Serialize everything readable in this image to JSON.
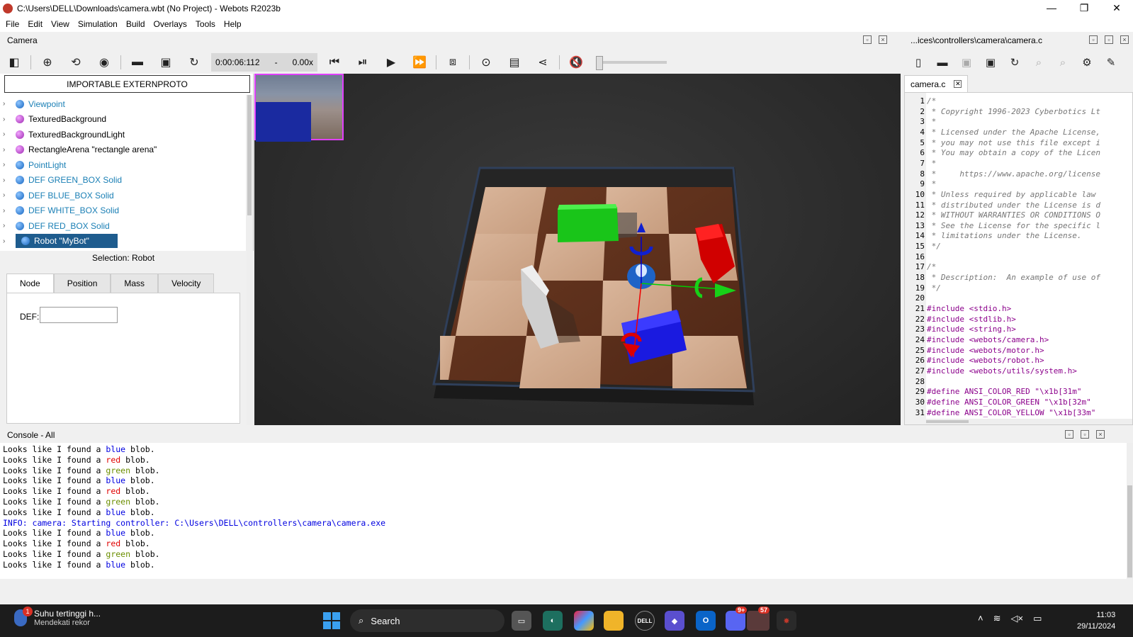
{
  "window": {
    "title": "C:\\Users\\DELL\\Downloads\\camera.wbt (No Project) - Webots R2023b",
    "minimize": "—",
    "maximize": "❐",
    "close": "✕"
  },
  "menu": [
    "File",
    "Edit",
    "View",
    "Simulation",
    "Build",
    "Overlays",
    "Tools",
    "Help"
  ],
  "camera_panel": {
    "title": "Camera"
  },
  "toolbar": {
    "time": "0:00:06:112",
    "separator": "-",
    "speed": "0.00x"
  },
  "scene_tree": {
    "extern_button": "IMPORTABLE EXTERNPROTO",
    "items": [
      {
        "label": "Viewpoint",
        "color": "blue",
        "text_color": "#1a7fb5"
      },
      {
        "label": "TexturedBackground",
        "color": "purple",
        "text_color": "#000000"
      },
      {
        "label": "TexturedBackgroundLight",
        "color": "purple",
        "text_color": "#000000"
      },
      {
        "label": "RectangleArena \"rectangle arena\"",
        "color": "purple",
        "text_color": "#000000"
      },
      {
        "label": "PointLight",
        "color": "blue",
        "text_color": "#1a7fb5"
      },
      {
        "label": "DEF GREEN_BOX Solid",
        "color": "blue",
        "text_color": "#1a7fb5"
      },
      {
        "label": "DEF BLUE_BOX Solid",
        "color": "blue",
        "text_color": "#1a7fb5"
      },
      {
        "label": "DEF WHITE_BOX Solid",
        "color": "blue",
        "text_color": "#1a7fb5"
      },
      {
        "label": "DEF RED_BOX Solid",
        "color": "blue",
        "text_color": "#1a7fb5"
      },
      {
        "label": "Robot \"MyBot\"",
        "color": "blue",
        "text_color": "#ffffff",
        "selected": true
      }
    ]
  },
  "selection": {
    "title": "Selection: Robot",
    "tabs": [
      "Node",
      "Position",
      "Mass",
      "Velocity"
    ],
    "active_tab": "Node",
    "def_label": "DEF:",
    "def_value": ""
  },
  "editor": {
    "title": "...ices\\controllers\\camera\\camera.c",
    "tab_label": "camera.c",
    "tab_close": "✕",
    "lines": [
      {
        "n": "1",
        "t": "/*",
        "k": "cmt"
      },
      {
        "n": "2",
        "t": " * Copyright 1996-2023 Cyberbotics Lt",
        "k": "cmt"
      },
      {
        "n": "3",
        "t": " *",
        "k": "cmt"
      },
      {
        "n": "4",
        "t": " * Licensed under the Apache License,",
        "k": "cmt"
      },
      {
        "n": "5",
        "t": " * you may not use this file except i",
        "k": "cmt"
      },
      {
        "n": "6",
        "t": " * You may obtain a copy of the Licen",
        "k": "cmt"
      },
      {
        "n": "7",
        "t": " *",
        "k": "cmt"
      },
      {
        "n": "8",
        "t": " *     https://www.apache.org/license",
        "k": "cmt"
      },
      {
        "n": "9",
        "t": " *",
        "k": "cmt"
      },
      {
        "n": "10",
        "t": " * Unless required by applicable law ",
        "k": "cmt"
      },
      {
        "n": "11",
        "t": " * distributed under the License is d",
        "k": "cmt"
      },
      {
        "n": "12",
        "t": " * WITHOUT WARRANTIES OR CONDITIONS O",
        "k": "cmt"
      },
      {
        "n": "13",
        "t": " * See the License for the specific l",
        "k": "cmt"
      },
      {
        "n": "14",
        "t": " * limitations under the License.",
        "k": "cmt"
      },
      {
        "n": "15",
        "t": " */",
        "k": "cmt"
      },
      {
        "n": "16",
        "t": "",
        "k": "cmt"
      },
      {
        "n": "17",
        "t": "/*",
        "k": "cmt"
      },
      {
        "n": "18",
        "t": " * Description:  An example of use of",
        "k": "cmt"
      },
      {
        "n": "19",
        "t": " */",
        "k": "cmt"
      },
      {
        "n": "20",
        "t": "",
        "k": "cmt"
      },
      {
        "n": "21",
        "t": "#include <stdio.h>",
        "k": "pp"
      },
      {
        "n": "22",
        "t": "#include <stdlib.h>",
        "k": "pp"
      },
      {
        "n": "23",
        "t": "#include <string.h>",
        "k": "pp"
      },
      {
        "n": "24",
        "t": "#include <webots/camera.h>",
        "k": "pp"
      },
      {
        "n": "25",
        "t": "#include <webots/motor.h>",
        "k": "pp"
      },
      {
        "n": "26",
        "t": "#include <webots/robot.h>",
        "k": "pp"
      },
      {
        "n": "27",
        "t": "#include <webots/utils/system.h>",
        "k": "pp"
      },
      {
        "n": "28",
        "t": "",
        "k": "pp"
      },
      {
        "n": "29",
        "t": "#define ANSI_COLOR_RED \"\\x1b[31m\"",
        "k": "pp"
      },
      {
        "n": "30",
        "t": "#define ANSI_COLOR_GREEN \"\\x1b[32m\"",
        "k": "pp"
      },
      {
        "n": "31",
        "t": "#define ANSI_COLOR_YELLOW \"\\x1b[33m\"",
        "k": "pp"
      }
    ]
  },
  "console": {
    "title": "Console - All",
    "lines": [
      {
        "pre": "Looks like I found a ",
        "word": "blue",
        "post": " blob.",
        "color": "blue"
      },
      {
        "pre": "Looks like I found a ",
        "word": "red",
        "post": " blob.",
        "color": "red"
      },
      {
        "pre": "Looks like I found a ",
        "word": "green",
        "post": " blob.",
        "color": "green"
      },
      {
        "pre": "Looks like I found a ",
        "word": "blue",
        "post": " blob.",
        "color": "blue"
      },
      {
        "pre": "Looks like I found a ",
        "word": "red",
        "post": " blob.",
        "color": "red"
      },
      {
        "pre": "Looks like I found a ",
        "word": "green",
        "post": " blob.",
        "color": "green"
      },
      {
        "pre": "Looks like I found a ",
        "word": "blue",
        "post": " blob.",
        "color": "blue"
      },
      {
        "pre": "INFO: camera: Starting controller: C:\\Users\\DELL\\controllers\\camera\\camera.exe",
        "word": "",
        "post": "",
        "color": "info"
      },
      {
        "pre": "Looks like I found a ",
        "word": "blue",
        "post": " blob.",
        "color": "blue"
      },
      {
        "pre": "Looks like I found a ",
        "word": "red",
        "post": " blob.",
        "color": "red"
      },
      {
        "pre": "Looks like I found a ",
        "word": "green",
        "post": " blob.",
        "color": "green"
      },
      {
        "pre": "Looks like I found a ",
        "word": "blue",
        "post": " blob.",
        "color": "blue"
      }
    ]
  },
  "taskbar": {
    "weather_title": "Suhu tertinggi h...",
    "weather_sub": "Mendekati rekor",
    "weather_badge": "1",
    "search_label": "Search",
    "discord_badge": "9+",
    "telegram_badge": "57",
    "dell_label": "DELL",
    "time": "11:03",
    "date": "29/11/2024"
  }
}
